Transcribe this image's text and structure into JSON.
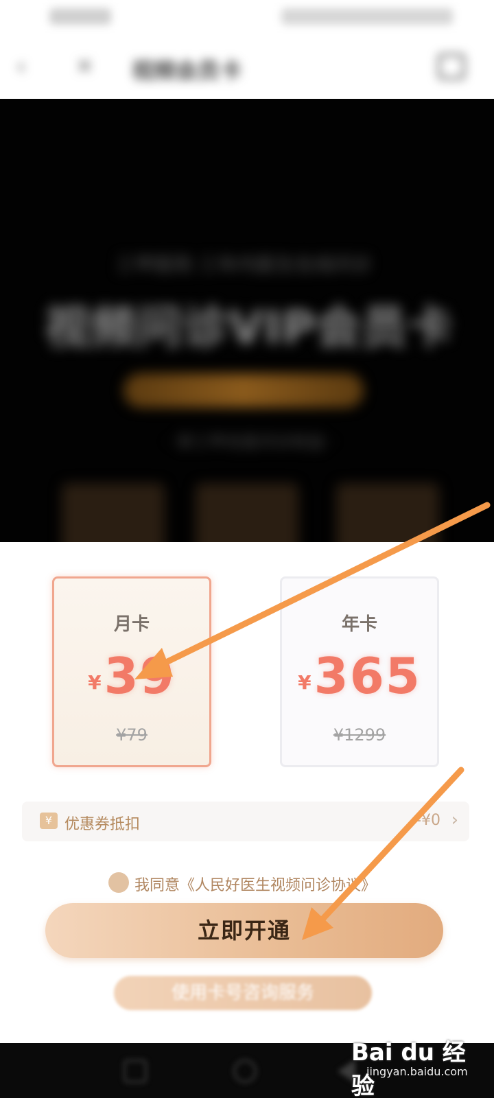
{
  "nav": {
    "back_icon": "‹",
    "close_icon": "×",
    "title": "视频会员卡"
  },
  "hero": {
    "subtitle": "三甲医院 三年内医生在线问诊",
    "headline": "视频问诊VIP会员卡",
    "tagline": "· 享三甲名医问诊权益 ·"
  },
  "plans": [
    {
      "name": "月卡",
      "currency": "¥",
      "price": "39",
      "original": "¥79"
    },
    {
      "name": "年卡",
      "currency": "¥",
      "price": "365",
      "original": "¥1299"
    }
  ],
  "coupon": {
    "icon": "¥",
    "label": "优惠券抵扣",
    "value": "-¥0",
    "chevron": "›"
  },
  "agreement": {
    "text": "我同意《人民好医生视频问诊协议》"
  },
  "actions": {
    "primary": "立即开通",
    "secondary": "使用卡号咨询服务"
  },
  "watermark": {
    "logo": "Bai du 经验",
    "url": "jingyan.baidu.com"
  },
  "colors": {
    "price": "#f27a67",
    "accent_gold": "#e9bc94",
    "arrow": "#f59a4a"
  }
}
